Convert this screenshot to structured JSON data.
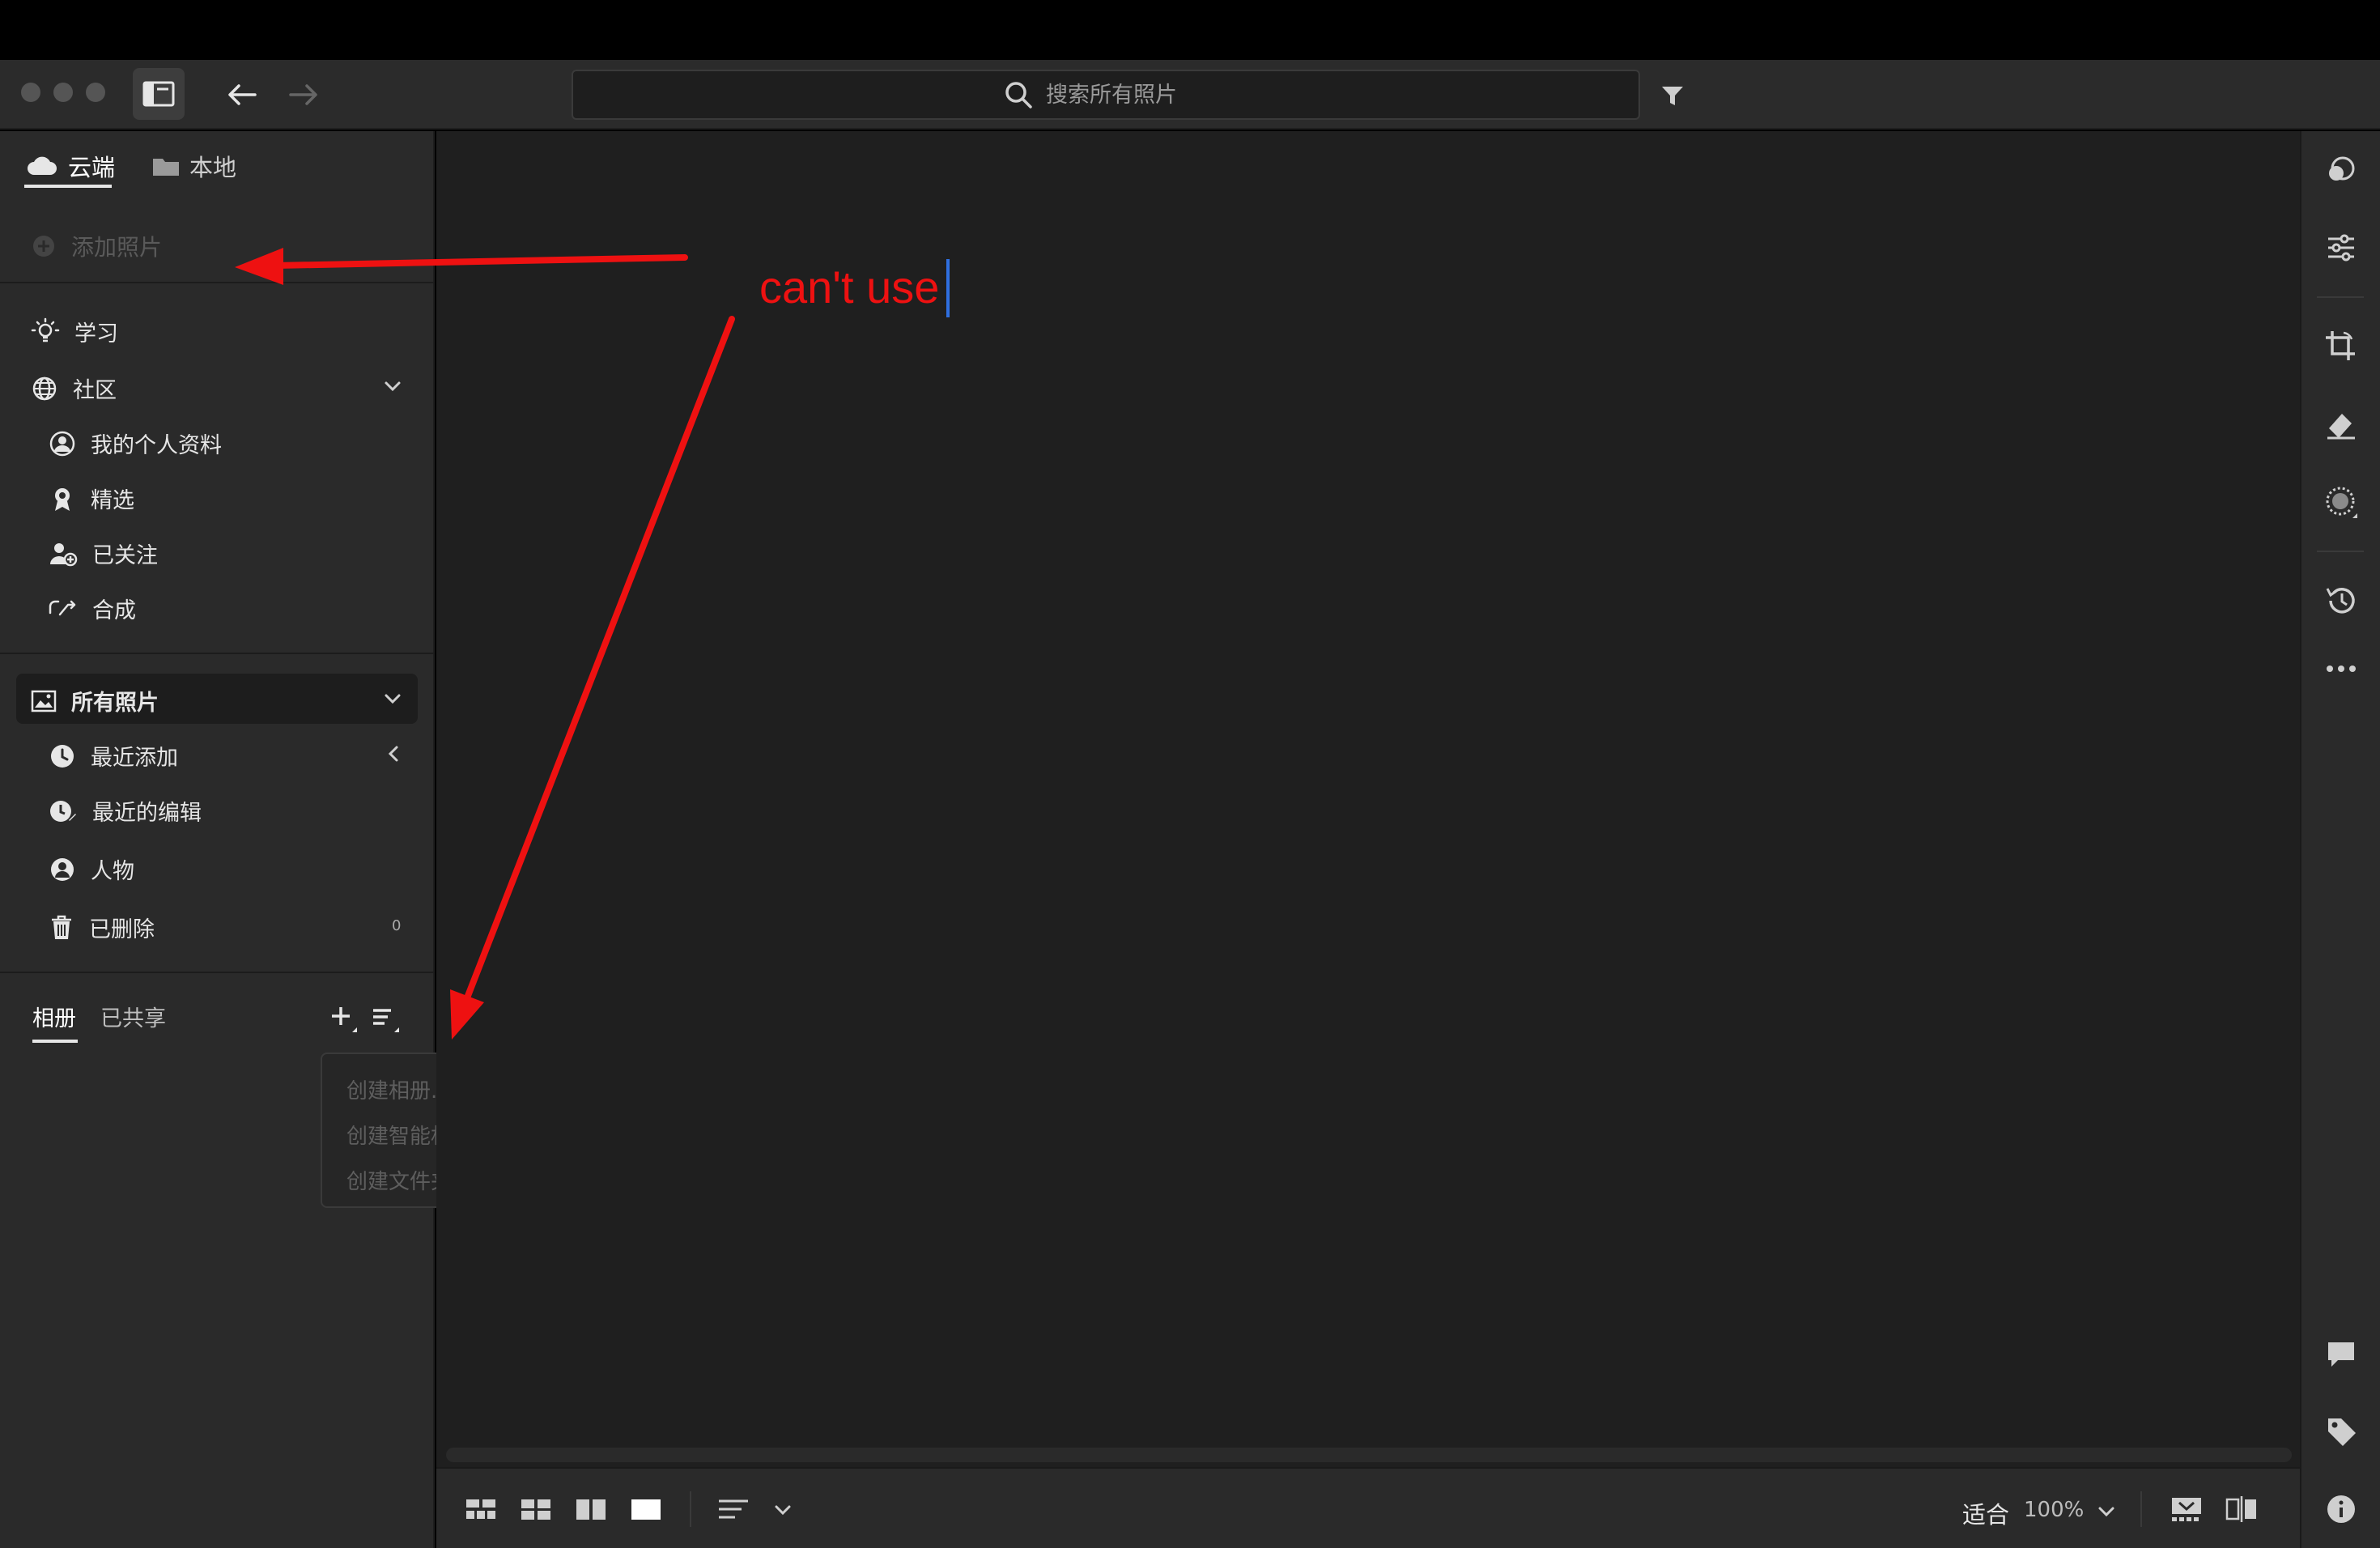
{
  "search": {
    "placeholder": "搜索所有照片"
  },
  "sidebar": {
    "tabs": [
      {
        "label": "云端"
      },
      {
        "label": "本地"
      }
    ],
    "add_photos": "添加照片",
    "learn": "学习",
    "community": {
      "label": "社区",
      "items": [
        {
          "label": "我的个人资料"
        },
        {
          "label": "精选"
        },
        {
          "label": "已关注"
        },
        {
          "label": "合成"
        }
      ]
    },
    "all_photos": {
      "label": "所有照片",
      "items": [
        {
          "label": "最近添加"
        },
        {
          "label": "最近的编辑"
        },
        {
          "label": "人物"
        },
        {
          "label": "已删除",
          "count": "0"
        }
      ]
    },
    "albums_tabs": [
      {
        "label": "相册"
      },
      {
        "label": "已共享"
      }
    ]
  },
  "dropdown": {
    "items": [
      {
        "label": "创建相册..."
      },
      {
        "label": "创建智能相册..."
      },
      {
        "label": "创建文件夹..."
      }
    ]
  },
  "annotation": {
    "text": "can't use",
    "color": "#ee1111"
  },
  "bottom_bar": {
    "fit_label": "适合",
    "zoom_value": "100%"
  }
}
